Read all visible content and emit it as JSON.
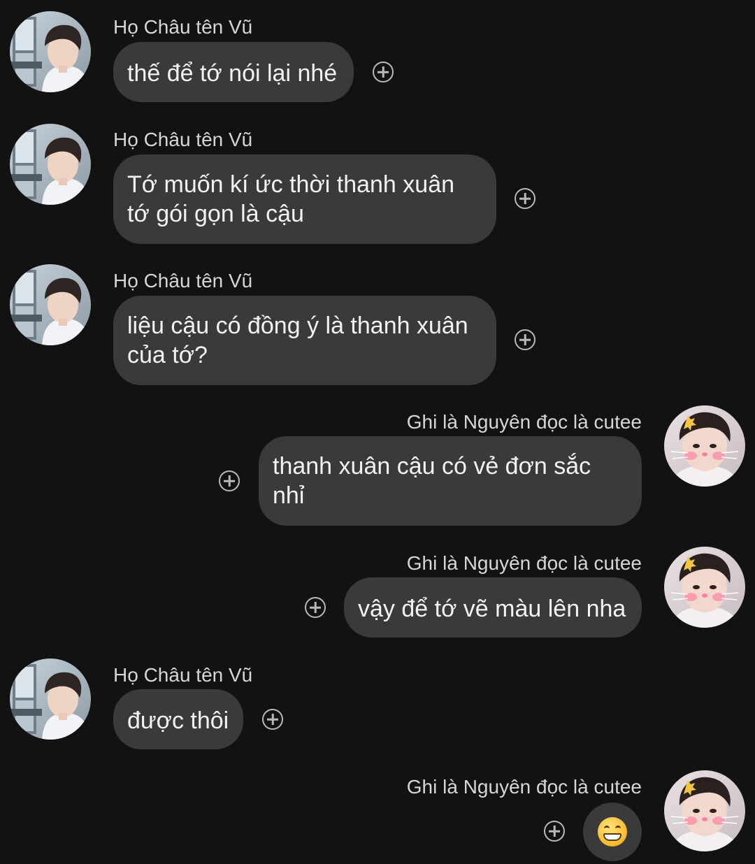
{
  "messages": [
    {
      "sender": "Họ Châu tên Vũ",
      "side": "left",
      "text": "thế để tớ nói lại nhé",
      "avatar_icon": "boy-looking-window-avatar"
    },
    {
      "sender": "Họ Châu tên Vũ",
      "side": "left",
      "text": "Tớ muốn kí ức thời thanh xuân tớ gói gọn là cậu",
      "avatar_icon": "boy-looking-window-avatar"
    },
    {
      "sender": "Họ Châu tên Vũ",
      "side": "left",
      "text": "liệu cậu có đồng ý là thanh xuân của tớ?",
      "avatar_icon": "boy-looking-window-avatar"
    },
    {
      "sender": "Ghi là Nguyên đọc là cutee",
      "side": "right",
      "text": "thanh xuân cậu có vẻ đơn sắc nhỉ",
      "avatar_icon": "boy-cat-filter-avatar"
    },
    {
      "sender": "Ghi là Nguyên đọc là cutee",
      "side": "right",
      "text": "vậy để tớ vẽ màu lên nha",
      "avatar_icon": "boy-cat-filter-avatar"
    },
    {
      "sender": "Họ Châu tên Vũ",
      "side": "left",
      "text": "được thôi",
      "avatar_icon": "boy-looking-window-avatar"
    },
    {
      "sender": "Ghi là Nguyên đọc là cutee",
      "side": "right",
      "text": "",
      "emoji": "grinning-face-emoji",
      "avatar_icon": "boy-cat-filter-avatar"
    }
  ],
  "colors": {
    "background": "#121212",
    "bubble": "#3a3a3a",
    "text": "#f2f2f2",
    "sender_name": "#d6d6d6",
    "react_icon": "#b9b9b9"
  }
}
